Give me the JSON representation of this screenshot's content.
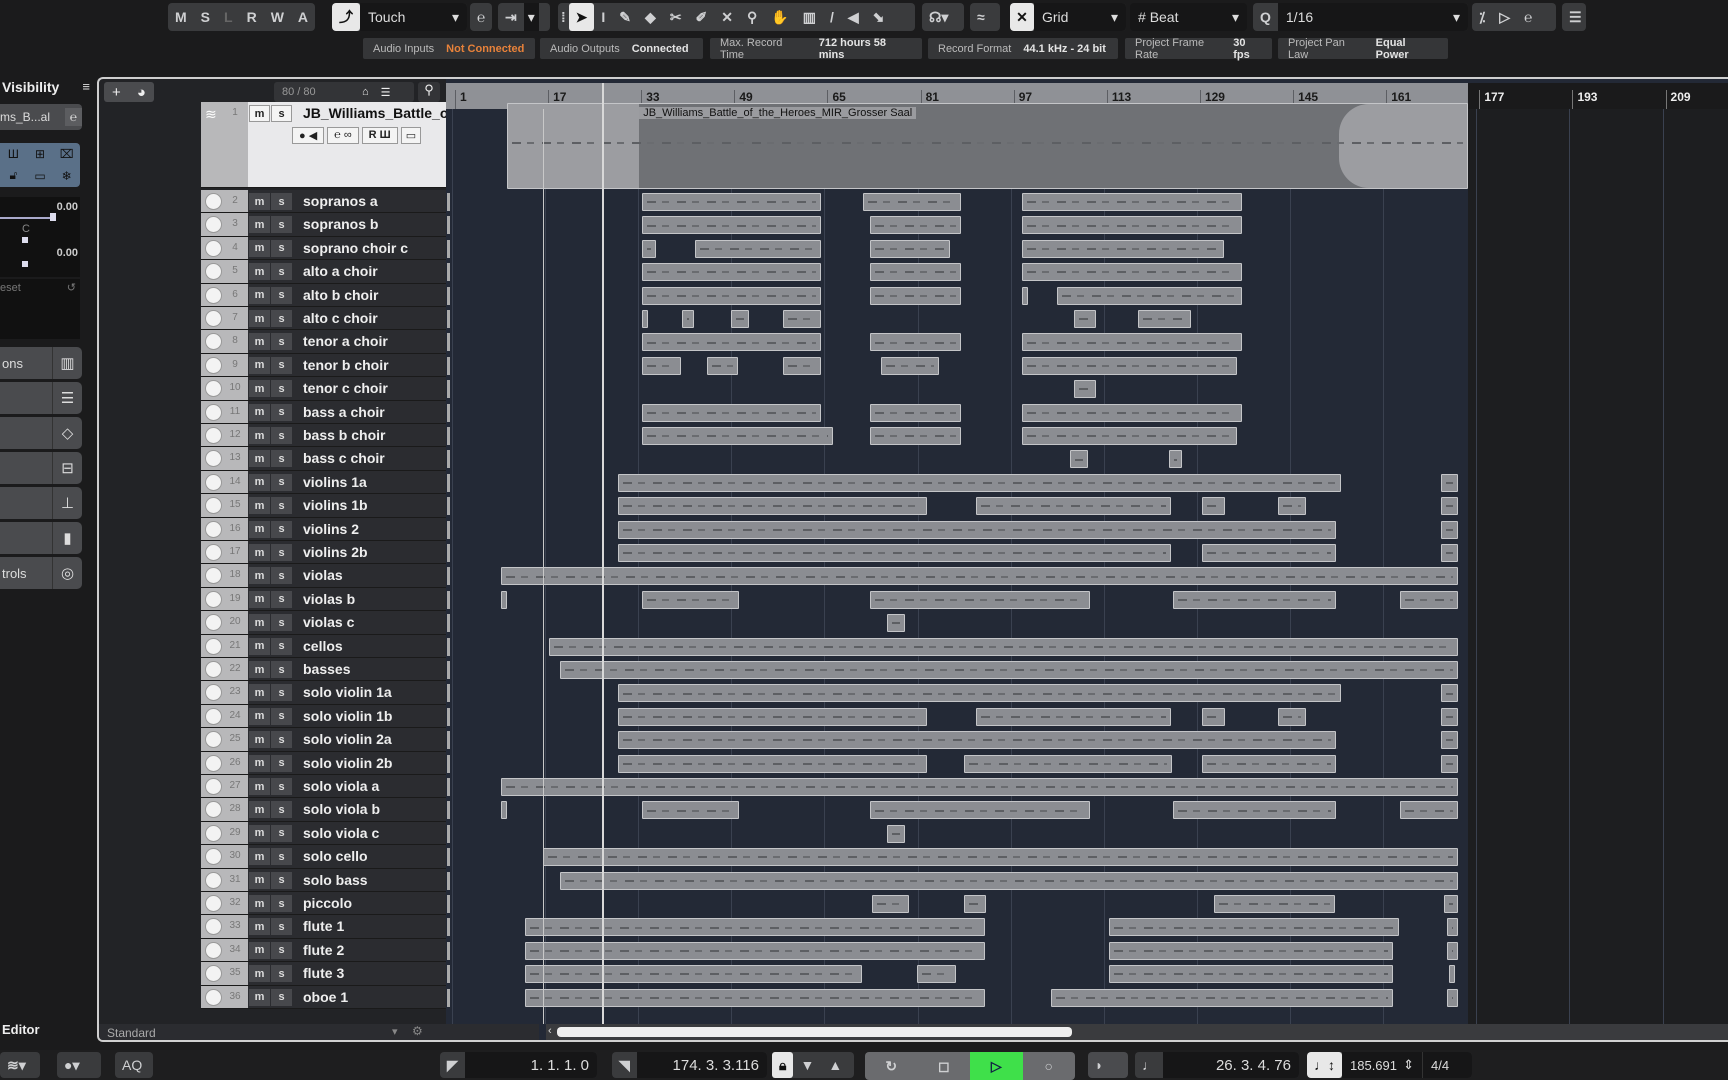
{
  "toolbar": {
    "automation_buttons": [
      "M",
      "S",
      "L",
      "R",
      "W",
      "A"
    ],
    "automation_mode": "Touch",
    "snap_type": "Grid",
    "grid_type": "Beat",
    "quantize_label": "Q",
    "quantize_value": "1/16",
    "tools": [
      "pointer-icon",
      "range-icon",
      "pencil-icon",
      "eraser-icon",
      "scissors-icon",
      "glue-icon",
      "mute-tool-icon",
      "zoom-icon",
      "hand-icon",
      "comp-icon",
      "line-icon",
      "speaker-icon",
      "color-icon"
    ]
  },
  "status": [
    {
      "label": "Audio Inputs",
      "value": "Not Connected",
      "warn": true
    },
    {
      "label": "Audio Outputs",
      "value": "Connected"
    },
    {
      "label": "Max. Record Time",
      "value": "712 hours 58 mins"
    },
    {
      "label": "Record Format",
      "value": "44.1 kHz - 24 bit"
    },
    {
      "label": "Project Frame Rate",
      "value": "30 fps"
    },
    {
      "label": "Project Pan Law",
      "value": "Equal Power"
    }
  ],
  "inspector": {
    "title": "Visibility",
    "track_name": "ms_B...al",
    "volume": "0.00",
    "pan": "C",
    "pan_value": "0.00",
    "preset": "eset",
    "sections": [
      "ons",
      "",
      "",
      "",
      "",
      "",
      "trols"
    ],
    "bottom_tab": "Editor"
  },
  "tracklist": {
    "count": "80 / 80",
    "footer": "Standard"
  },
  "ruler": {
    "labels": [
      1,
      17,
      33,
      49,
      65,
      81,
      97,
      113,
      129,
      145,
      161,
      177,
      193,
      209
    ],
    "project_end_bar": 175.6
  },
  "audio_track": {
    "number": "1",
    "name": "JB_Williams_Battle_of...al",
    "clip_name": "JB_Williams_Battle_of_the_Heroes_MIR_Grosser Saal",
    "clip": [
      10.5,
      175.6
    ],
    "meter": 0.55
  },
  "tracks": [
    {
      "n": 2,
      "name": "sopranos a",
      "parts": [
        [
          33.6,
          64.4
        ],
        [
          71.6,
          88.5
        ],
        [
          98.9,
          136.8
        ]
      ]
    },
    {
      "n": 3,
      "name": "sopranos b",
      "parts": [
        [
          33.6,
          64.4
        ],
        [
          72.8,
          88.5
        ],
        [
          98.9,
          136.8
        ]
      ]
    },
    {
      "n": 4,
      "name": "soprano choir c",
      "parts": [
        [
          33.6,
          36
        ],
        [
          42.7,
          64.4
        ],
        [
          72.8,
          86.5
        ],
        [
          98.9,
          133.6
        ]
      ]
    },
    {
      "n": 5,
      "name": "alto a choir",
      "parts": [
        [
          33.6,
          64.4
        ],
        [
          72.8,
          88.5
        ],
        [
          98.9,
          136.8
        ]
      ]
    },
    {
      "n": 6,
      "name": "alto b choir",
      "parts": [
        [
          33.6,
          64.4
        ],
        [
          72.8,
          88.5
        ],
        [
          98.9,
          99.7
        ],
        [
          105,
          136.8
        ]
      ]
    },
    {
      "n": 7,
      "name": "alto c choir",
      "parts": [
        [
          33.6,
          34.5
        ],
        [
          40.5,
          42.5
        ],
        [
          49,
          52
        ],
        [
          57.8,
          64.4
        ],
        [
          107.8,
          111.6
        ],
        [
          118.8,
          127.9
        ]
      ]
    },
    {
      "n": 8,
      "name": "tenor a choir",
      "parts": [
        [
          33.6,
          64.4
        ],
        [
          72.8,
          88.5
        ],
        [
          98.9,
          136.8
        ]
      ]
    },
    {
      "n": 9,
      "name": "tenor b choir",
      "parts": [
        [
          33.6,
          40.4
        ],
        [
          44.9,
          50.2
        ],
        [
          57.8,
          64.4
        ],
        [
          74.7,
          84.7
        ],
        [
          98.9,
          135.8
        ]
      ]
    },
    {
      "n": 10,
      "name": "tenor c choir",
      "parts": [
        [
          107.8,
          111.6
        ]
      ]
    },
    {
      "n": 11,
      "name": "bass a choir",
      "parts": [
        [
          33.6,
          64.4
        ],
        [
          72.8,
          88.5
        ],
        [
          98.9,
          136.8
        ]
      ]
    },
    {
      "n": 12,
      "name": "bass b choir",
      "parts": [
        [
          33.6,
          66.5
        ],
        [
          72.8,
          88.5
        ],
        [
          98.9,
          135.8
        ]
      ]
    },
    {
      "n": 13,
      "name": "bass c choir",
      "parts": [
        [
          107.2,
          110.2
        ],
        [
          124.2,
          126.5
        ]
      ]
    },
    {
      "n": 14,
      "name": "violins 1a",
      "parts": [
        [
          29.6,
          153.8
        ],
        [
          171,
          173.9
        ]
      ]
    },
    {
      "n": 15,
      "name": "violins 1b",
      "parts": [
        [
          29.6,
          82.6
        ],
        [
          91,
          124.5
        ],
        [
          129.9,
          133.9
        ],
        [
          143,
          147.8
        ],
        [
          171,
          173.9
        ]
      ]
    },
    {
      "n": 16,
      "name": "violins 2",
      "parts": [
        [
          29.6,
          152.9
        ],
        [
          171,
          173.9
        ]
      ]
    },
    {
      "n": 17,
      "name": "violins 2b",
      "parts": [
        [
          29.6,
          124.5
        ],
        [
          129.9,
          152.9
        ],
        [
          171,
          173.9
        ]
      ]
    },
    {
      "n": 18,
      "name": "violas",
      "parts": [
        [
          9.5,
          173.9
        ]
      ],
      "meter": 0.5
    },
    {
      "n": 19,
      "name": "violas b",
      "parts": [
        [
          9.5,
          10.3
        ],
        [
          33.6,
          50.4
        ],
        [
          72.8,
          110.7
        ],
        [
          124.9,
          152.9
        ],
        [
          163.9,
          173.9
        ]
      ]
    },
    {
      "n": 20,
      "name": "violas c",
      "parts": [
        [
          75.8,
          78.8
        ]
      ]
    },
    {
      "n": 21,
      "name": "cellos",
      "parts": [
        [
          17.7,
          173.9
        ]
      ],
      "meter": 0.7
    },
    {
      "n": 22,
      "name": "basses",
      "parts": [
        [
          19.6,
          173.9
        ]
      ],
      "meter": 0.4
    },
    {
      "n": 23,
      "name": "solo violin 1a",
      "parts": [
        [
          29.6,
          153.8
        ],
        [
          171,
          173.9
        ]
      ]
    },
    {
      "n": 24,
      "name": "solo violin 1b",
      "parts": [
        [
          29.6,
          82.6
        ],
        [
          91,
          124.5
        ],
        [
          129.9,
          133.9
        ],
        [
          143,
          147.8
        ],
        [
          171,
          173.9
        ]
      ]
    },
    {
      "n": 25,
      "name": "solo violin 2a",
      "parts": [
        [
          29.6,
          152.9
        ],
        [
          171,
          173.9
        ]
      ]
    },
    {
      "n": 26,
      "name": "solo violin 2b",
      "parts": [
        [
          29.6,
          82.6
        ],
        [
          88.9,
          124.7
        ],
        [
          129.9,
          152.9
        ],
        [
          171,
          173.9
        ]
      ]
    },
    {
      "n": 27,
      "name": "solo viola a",
      "parts": [
        [
          9.5,
          173.9
        ]
      ],
      "meter": 0.5
    },
    {
      "n": 28,
      "name": "solo viola b",
      "parts": [
        [
          9.5,
          10.3
        ],
        [
          33.6,
          50.4
        ],
        [
          72.8,
          110.7
        ],
        [
          124.9,
          152.9
        ],
        [
          163.9,
          173.9
        ]
      ]
    },
    {
      "n": 29,
      "name": "solo viola c",
      "parts": [
        [
          75.8,
          78.8
        ]
      ]
    },
    {
      "n": 30,
      "name": "solo cello",
      "parts": [
        [
          16.7,
          173.9
        ]
      ],
      "meter": 0.7
    },
    {
      "n": 31,
      "name": "solo bass",
      "parts": [
        [
          19.6,
          173.9
        ]
      ],
      "meter": 0.5
    },
    {
      "n": 32,
      "name": "piccolo",
      "parts": [
        [
          73.2,
          79.6
        ],
        [
          88.9,
          92.7
        ],
        [
          132,
          152.7
        ],
        [
          171.5,
          173.9
        ]
      ]
    },
    {
      "n": 33,
      "name": "flute 1",
      "parts": [
        [
          13.5,
          92.5
        ],
        [
          113.9,
          163.7
        ],
        [
          172,
          173.9
        ]
      ],
      "meter": 0.7
    },
    {
      "n": 34,
      "name": "flute 2",
      "parts": [
        [
          13.5,
          92.5
        ],
        [
          113.9,
          162.7
        ],
        [
          172,
          173.9
        ]
      ],
      "meter": 0.6
    },
    {
      "n": 35,
      "name": "flute 3",
      "parts": [
        [
          13.5,
          71.5
        ],
        [
          80.9,
          87.6
        ],
        [
          113.9,
          162.7
        ],
        [
          172.3,
          173.2
        ]
      ],
      "meter": 0.5
    },
    {
      "n": 36,
      "name": "oboe 1",
      "parts": [
        [
          13.5,
          92.5
        ],
        [
          104,
          162.7
        ],
        [
          172,
          173.9
        ]
      ],
      "meter": 0.6
    }
  ],
  "transport": {
    "left_locator": "1. 1. 1.  0",
    "right_locator": "174. 3. 3.116",
    "position": "26. 3. 4. 76",
    "tempo": "185.691",
    "signature": "4/4",
    "aq": "AQ"
  },
  "colors": {
    "accent_green": "#3fe04a",
    "meter": "#3ce0c0",
    "warning": "#e8823a"
  }
}
